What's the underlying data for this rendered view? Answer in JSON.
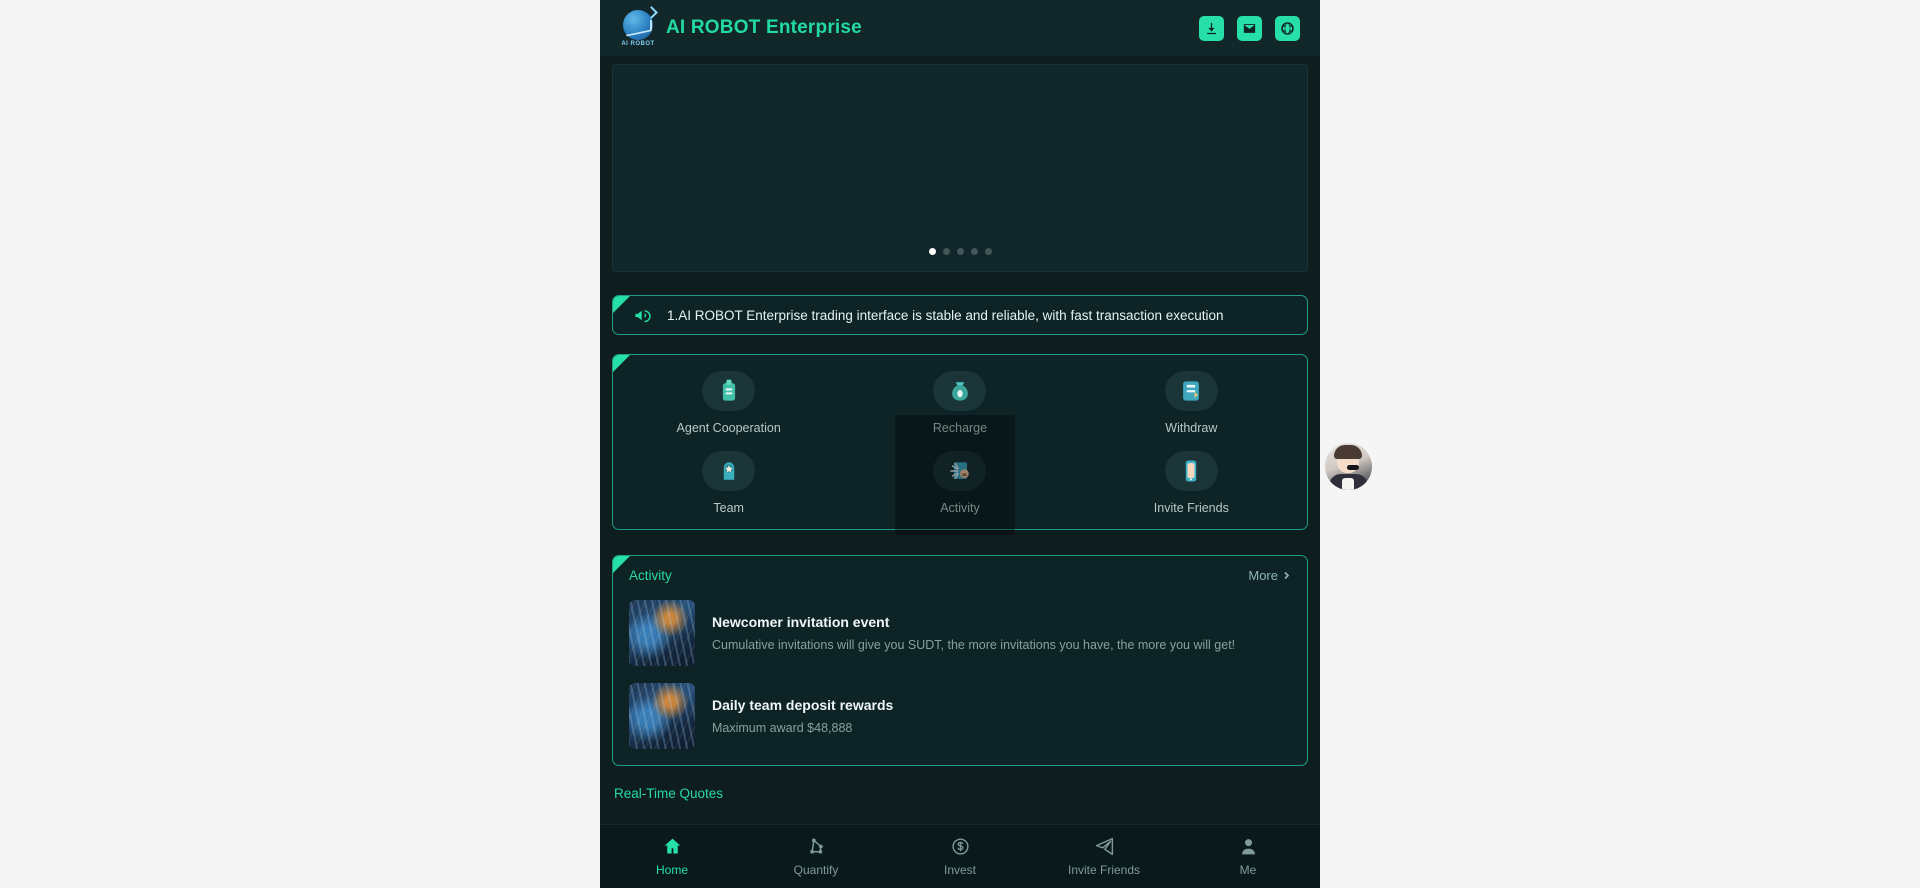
{
  "header": {
    "logo_alt": "AI ROBOT",
    "title": "AI ROBOT Enterprise",
    "icons": [
      {
        "name": "download-icon",
        "label": "Download"
      },
      {
        "name": "mail-icon",
        "label": "Mail"
      },
      {
        "name": "globe-icon",
        "label": "Language"
      }
    ]
  },
  "banner": {
    "slide_count": 5,
    "active_slide": 1
  },
  "notice": {
    "icon": "megaphone-icon",
    "text": "1.AI ROBOT Enterprise trading interface is stable and reliable, with fast transaction execution"
  },
  "menu": {
    "items": [
      {
        "label": "Agent Cooperation",
        "icon": "badge-icon"
      },
      {
        "label": "Recharge",
        "icon": "money-bag-icon"
      },
      {
        "label": "Withdraw",
        "icon": "withdraw-card-icon"
      },
      {
        "label": "Team",
        "icon": "team-star-icon"
      },
      {
        "label": "Activity",
        "icon": "activity-icon"
      },
      {
        "label": "Invite Friends",
        "icon": "phone-invite-icon"
      }
    ]
  },
  "activity": {
    "title": "Activity",
    "more_label": "More",
    "items": [
      {
        "name": "Newcomer invitation event",
        "desc": "Cumulative invitations will give you SUDT, the more invitations you have, the more you will get!"
      },
      {
        "name": "Daily team deposit rewards",
        "desc": "Maximum award $48,888"
      }
    ]
  },
  "quotes": {
    "title": "Real-Time Quotes"
  },
  "tabbar": {
    "items": [
      {
        "label": "Home",
        "icon": "home-icon",
        "active": true
      },
      {
        "label": "Quantify",
        "icon": "quantify-icon",
        "active": false
      },
      {
        "label": "Invest",
        "icon": "invest-dollar-icon",
        "active": false
      },
      {
        "label": "Invite Friends",
        "icon": "send-plane-icon",
        "active": false
      },
      {
        "label": "Me",
        "icon": "person-icon",
        "active": false
      }
    ]
  },
  "support": {
    "avatar_alt": "customer-service-agent"
  },
  "colors": {
    "accent": "#27e0a8",
    "accent_text": "#27d9a4",
    "page_bg": "#f5f5f5",
    "app_bg": "#0e1e1f",
    "header_bg": "#12272a",
    "card_bg": "#0d2326",
    "card_border": "#1f9d86",
    "tabbar_bg": "#0a1a1c",
    "muted_text": "#87a19f"
  }
}
